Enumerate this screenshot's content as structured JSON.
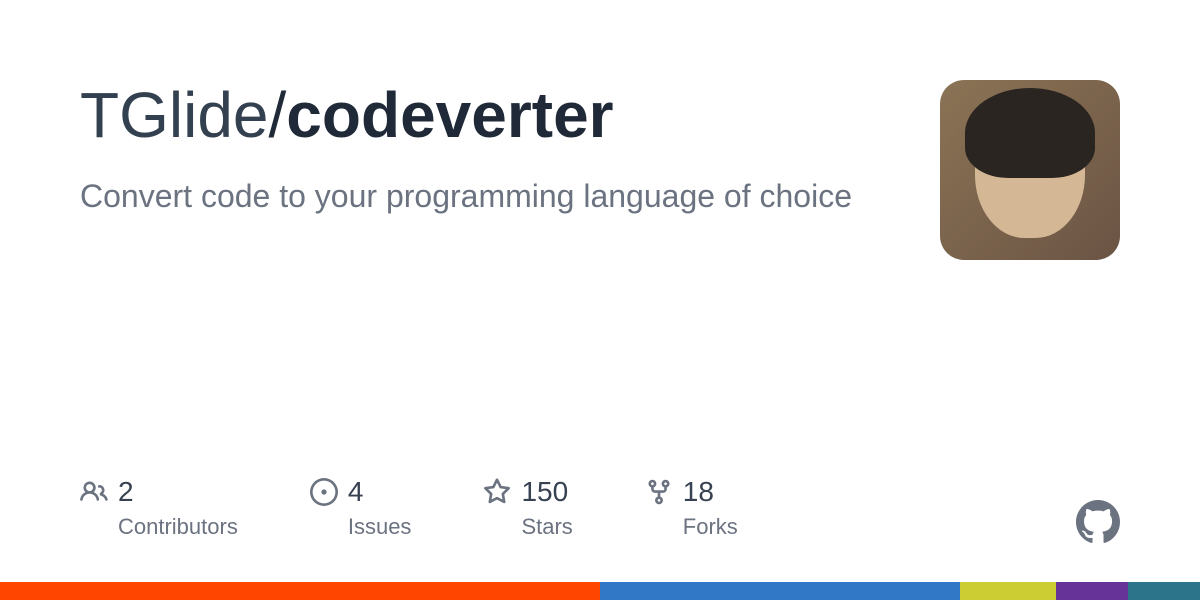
{
  "repo": {
    "owner": "TGlide",
    "separator": "/",
    "name": "codeverter",
    "description": "Convert code to your programming language of choice"
  },
  "stats": {
    "contributors": {
      "value": "2",
      "label": "Contributors"
    },
    "issues": {
      "value": "4",
      "label": "Issues"
    },
    "stars": {
      "value": "150",
      "label": "Stars"
    },
    "forks": {
      "value": "18",
      "label": "Forks"
    }
  }
}
